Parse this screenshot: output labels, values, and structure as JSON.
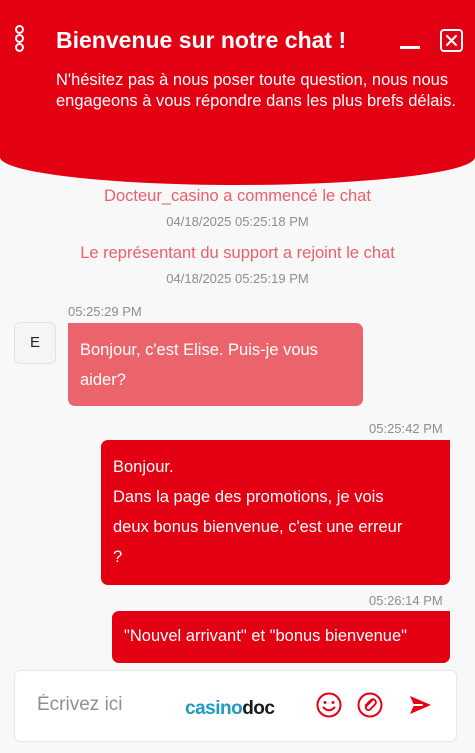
{
  "header": {
    "title": "Bienvenue sur notre chat !",
    "subtitle": "N'hésitez pas à nous poser toute question, nous nous engageons à vous répondre dans les plus brefs délais."
  },
  "events": [
    {
      "text": "Docteur_casino a commencé le chat",
      "time": "04/18/2025 05:25:18 PM"
    },
    {
      "text": "Le représentant du support a rejoint le chat",
      "time": "04/18/2025 05:25:19 PM"
    }
  ],
  "messages": [
    {
      "sender": "agent",
      "avatar_initial": "E",
      "time": "05:25:29 PM",
      "lines": [
        "Bonjour, c'est Elise. Puis-je vous",
        "aider?"
      ]
    },
    {
      "sender": "user",
      "time": "05:25:42 PM",
      "lines": [
        "Bonjour.",
        "Dans la page des promotions, je vois",
        "deux bonus bienvenue, c'est une erreur",
        "?"
      ]
    },
    {
      "sender": "user",
      "time": "05:26:14 PM",
      "lines": [
        "\"Nouvel arrivant\" et \"bonus bienvenue\""
      ]
    }
  ],
  "composer": {
    "placeholder": "Écrivez ici",
    "brand_part1": "casino",
    "brand_part2": "doc",
    "icons": [
      "emoji-icon",
      "attachment-icon",
      "send-icon"
    ]
  },
  "colors": {
    "brand_red": "#e30012",
    "agent_bubble": "#ec646b",
    "system_text": "#e9606a",
    "timestamp": "#8d8d8d"
  }
}
